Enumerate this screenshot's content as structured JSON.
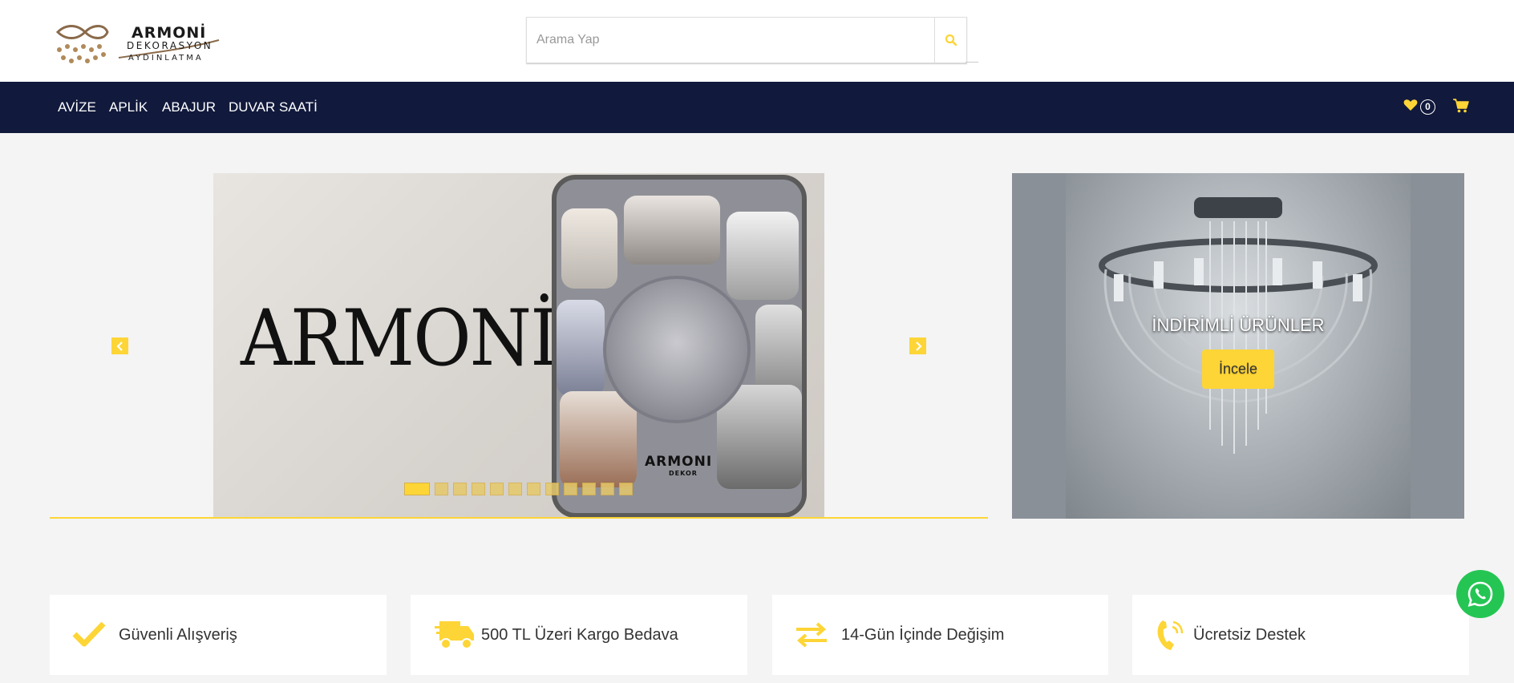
{
  "header": {
    "logo": {
      "line1": "ARMONİ",
      "line2": "DEKORASYON",
      "line3": "AYDINLATMA"
    },
    "search": {
      "placeholder": "Arama Yap"
    }
  },
  "nav": {
    "items": [
      "AVİZE",
      "APLİK",
      "ABAJUR",
      "DUVAR SAATİ"
    ],
    "favorites_count": "0"
  },
  "slider": {
    "brand_word": "ARMONİ",
    "catalog_title": "ARMONI",
    "catalog_subtitle": "DEKOR",
    "slide_count": 12,
    "active_slide": 1
  },
  "promo": {
    "title": "İNDİRİMLİ ÜRÜNLER",
    "button": "İncele"
  },
  "features": [
    {
      "label": "Güvenli Alışveriş",
      "icon": "check-icon"
    },
    {
      "label": "500 TL Üzeri Kargo Bedava",
      "icon": "truck-icon"
    },
    {
      "label": "14-Gün İçinde Değişim",
      "icon": "exchange-icon"
    },
    {
      "label": "Ücretsiz Destek",
      "icon": "phone-icon"
    }
  ],
  "colors": {
    "accent": "#fdd536",
    "nav_bg": "#11193c",
    "page_bg": "#f4f4f4",
    "whatsapp": "#25c554"
  }
}
